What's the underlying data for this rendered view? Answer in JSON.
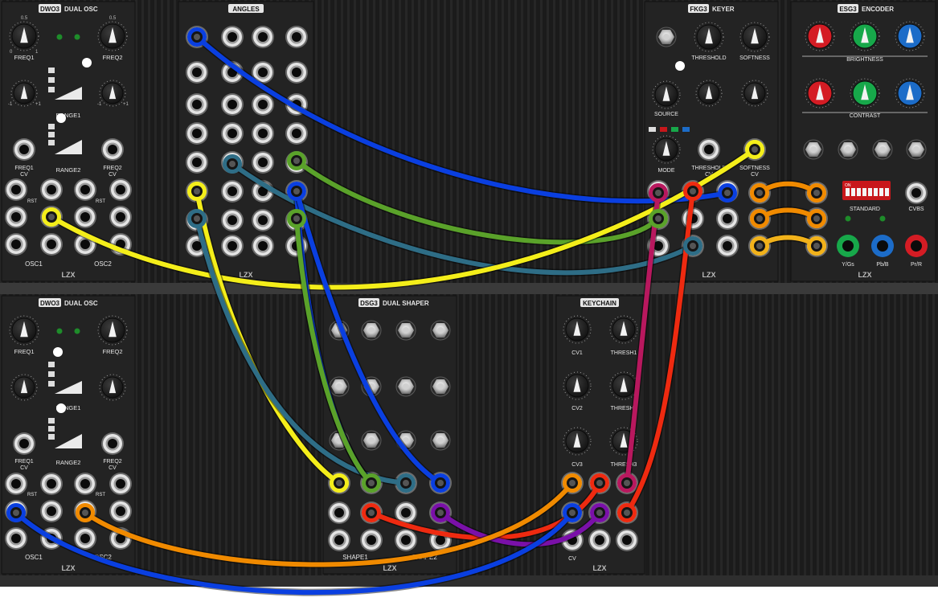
{
  "modules": {
    "dwo3_top": {
      "badge": "DWO3",
      "title": "DUAL OSC",
      "freq1": "FREQ1",
      "freq2": "FREQ2",
      "range1": "RANGE1",
      "range2": "RANGE2",
      "freq1cv": "FREQ1",
      "freq2cv": "FREQ2",
      "cv": "CV",
      "rst": "RST",
      "osc1": "OSC1",
      "osc2": "OSC2",
      "scale_05": "0.5",
      "scale_0": "0",
      "scale_1": "1",
      "scale_m1": "-1",
      "scale_p1": "+1",
      "brand": "LZX"
    },
    "angles": {
      "title": "ANGLES",
      "brand": "LZX"
    },
    "fkg3": {
      "badge": "FKG3",
      "title": "KEYER",
      "threshold": "THRESHOLD",
      "softness": "SOFTNESS",
      "source": "SOURCE",
      "mode": "MODE",
      "threshold_cv": "THRESHOLD",
      "softness_cv": "SOFTNESS",
      "cv": "CV",
      "brand": "LZX"
    },
    "esg3": {
      "badge": "ESG3",
      "title": "ENCODER",
      "brightness": "BRIGHTNESS",
      "contrast": "CONTRAST",
      "standard": "STANDARD",
      "cvbs": "CVBS",
      "ygs": "Y/Gs",
      "pbb": "Pb/B",
      "prr": "Pr/R",
      "brand": "LZX",
      "dip_on": "ON"
    },
    "dwo3_bottom": {
      "badge": "DWO3",
      "title": "DUAL OSC",
      "freq1": "FREQ1",
      "freq2": "FREQ2",
      "range1": "RANGE1",
      "range2": "RANGE2",
      "freq1cv": "FREQ1",
      "freq2cv": "FREQ2",
      "cv": "CV",
      "rst": "RST",
      "osc1": "OSC1",
      "osc2": "OSC2",
      "brand": "LZX"
    },
    "dsg3": {
      "badge": "DSG3",
      "title": "DUAL SHAPER",
      "shape1": "SHAPE1",
      "shape2": "SHAPE2",
      "brand": "LZX"
    },
    "keychain": {
      "title": "KEYCHAIN",
      "cv1": "CV1",
      "cv2": "CV2",
      "cv3": "CV3",
      "thresh1": "THRESH1",
      "thresh2": "THRESH2",
      "thresh3": "THRESH3",
      "cv": "CV",
      "brand": "LZX"
    }
  },
  "cable_colors": {
    "blue": "#0a3fe0",
    "yellow": "#f4ee1a",
    "green": "#5aa22a",
    "teal": "#2e6d86",
    "red": "#ee2a10",
    "orange": "#f08a00",
    "magenta": "#b8185e",
    "purple": "#7a10a8",
    "gold": "#f2b21a"
  },
  "knob_colors": {
    "red": "#d41c24",
    "green": "#17a84a",
    "blue": "#1c6cc8"
  }
}
